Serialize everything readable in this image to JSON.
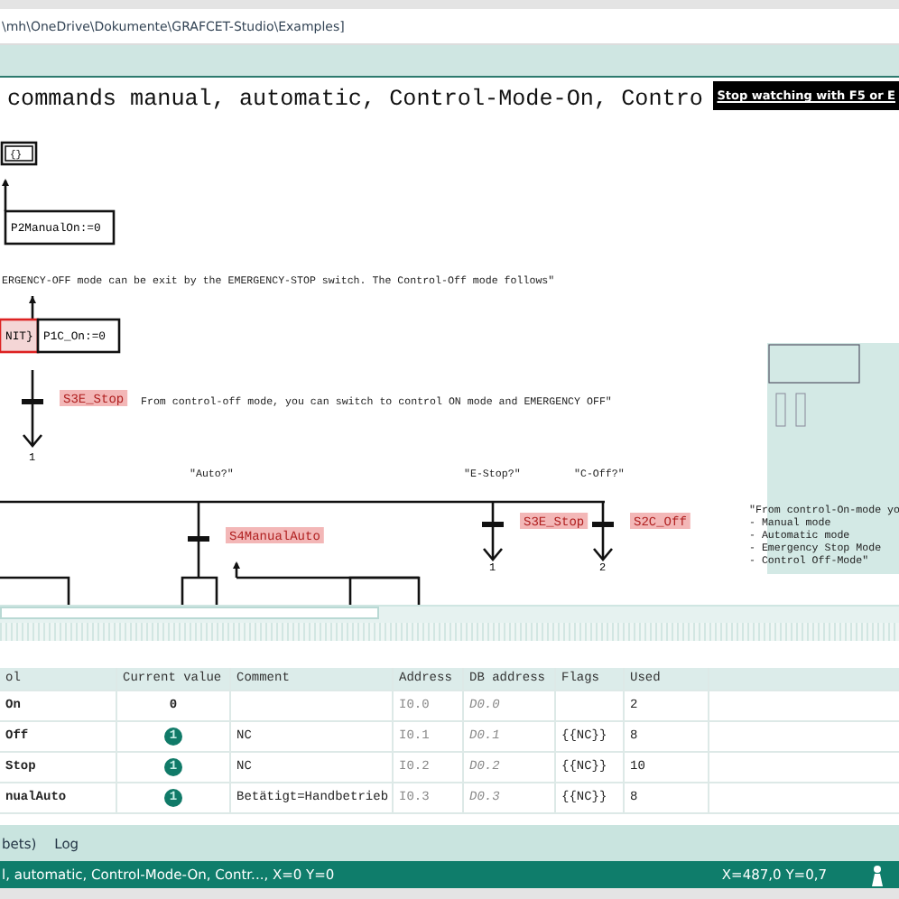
{
  "path_bar": {
    "text": "\\mh\\OneDrive\\Dokumente\\GRAFCET-Studio\\Examples]"
  },
  "canvas": {
    "title": "commands manual, automatic, Control-Mode-On, Contro",
    "tooltip": "Stop watching with F5 or E",
    "items": [
      {
        "kind": "double_action",
        "text": "{}"
      },
      {
        "kind": "action",
        "text": "P2ManualOn:=0"
      },
      {
        "kind": "comment",
        "text": "ERGENCY-OFF mode can be exit by the EMERGENCY-STOP switch. The Control-Off mode follows\""
      },
      {
        "kind": "active_action",
        "text": "NIT}"
      },
      {
        "kind": "action",
        "text": "P1C_On:=0"
      },
      {
        "kind": "condition",
        "text": "S3E_Stop"
      },
      {
        "kind": "comment",
        "text": "From control-off mode, you can switch to control ON mode and EMERGENCY OFF\""
      },
      {
        "kind": "target",
        "text": "1"
      },
      {
        "kind": "comment",
        "text": "\"Auto?\""
      },
      {
        "kind": "comment",
        "text": "\"E-Stop?\""
      },
      {
        "kind": "comment",
        "text": "\"C-Off?\""
      },
      {
        "kind": "condition",
        "text": "S4ManualAuto"
      },
      {
        "kind": "condition",
        "text": "S3E_Stop"
      },
      {
        "kind": "condition",
        "text": "S2C_Off"
      },
      {
        "kind": "target",
        "text": "1"
      },
      {
        "kind": "target",
        "text": "2"
      },
      {
        "kind": "comment",
        "text": "\"From control-On-mode yo"
      },
      {
        "kind": "comment",
        "text": "- Manual mode"
      },
      {
        "kind": "comment",
        "text": "- Automatic mode"
      },
      {
        "kind": "comment",
        "text": "- Emergency Stop Mode"
      },
      {
        "kind": "comment",
        "text": "- Control Off-Mode\""
      }
    ]
  },
  "table": {
    "columns": [
      "ol",
      "Current value",
      "Comment",
      "Address",
      "DB address",
      "Flags",
      "Used"
    ],
    "rows": [
      {
        "symbol": "On",
        "value": "0",
        "on": false,
        "comment": "",
        "address": "I0.0",
        "db_address": "D0.0",
        "flags": "",
        "used": "2"
      },
      {
        "symbol": "Off",
        "value": "1",
        "on": true,
        "comment": "NC",
        "address": "I0.1",
        "db_address": "D0.1",
        "flags": "{{NC}}",
        "used": "8"
      },
      {
        "symbol": "Stop",
        "value": "1",
        "on": true,
        "comment": "NC",
        "address": "I0.2",
        "db_address": "D0.2",
        "flags": "{{NC}}",
        "used": "10"
      },
      {
        "symbol": "nualAuto",
        "value": "1",
        "on": true,
        "comment": "Betätigt=Handbetrieb",
        "address": "I0.3",
        "db_address": "D0.3",
        "flags": "{{NC}}",
        "used": "8"
      }
    ]
  },
  "bottom_tabs": [
    "bets)",
    "Log"
  ],
  "status_bar": {
    "left": "l, automatic, Control-Mode-On, Contr..., X=0 Y=0",
    "right": "X=487,0  Y=0,7"
  }
}
